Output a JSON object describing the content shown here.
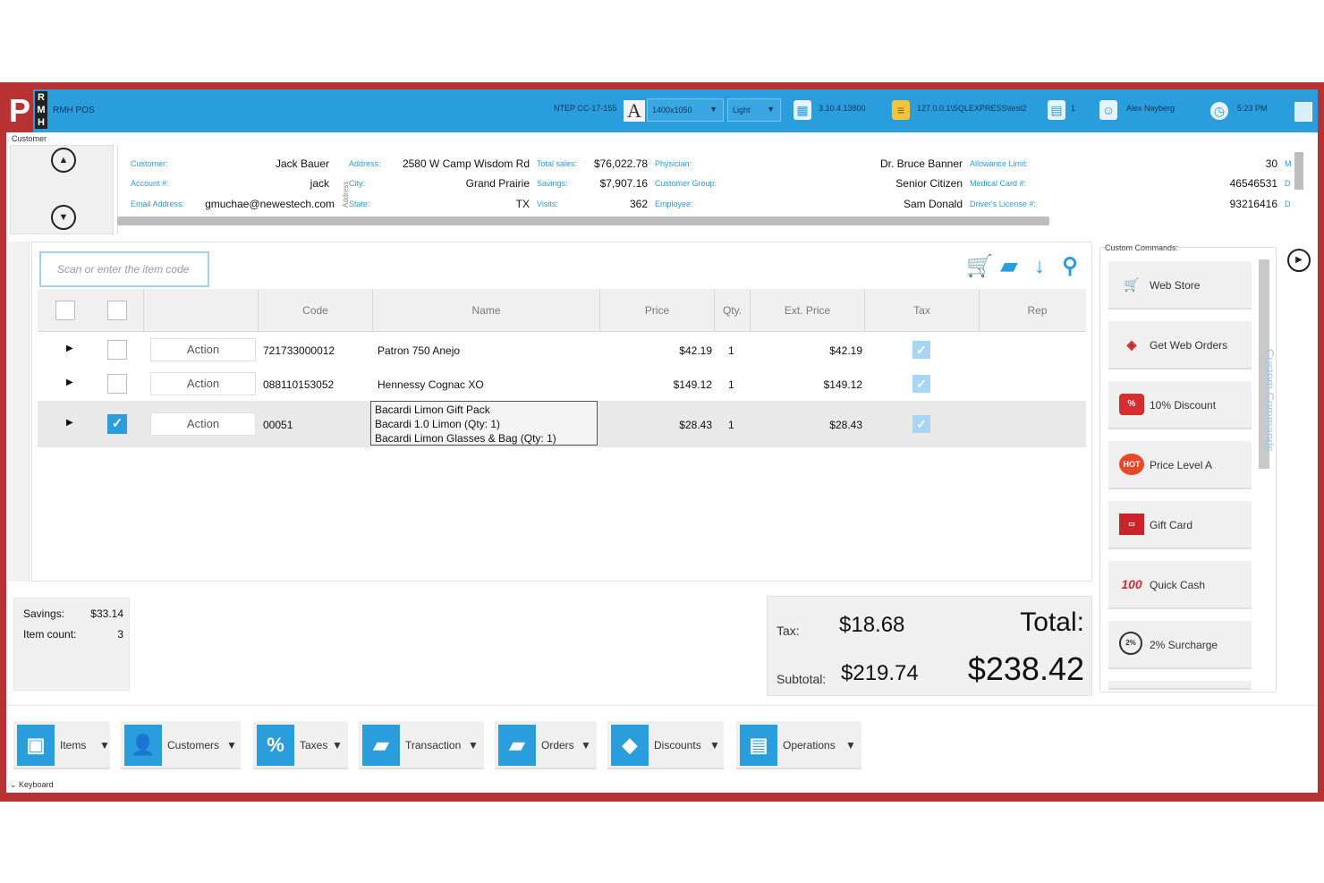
{
  "title_bar": {
    "logo_letter": "P",
    "logo_sub": [
      "R",
      "M",
      "H"
    ],
    "app_title": "RMH POS",
    "terminal": "NTEP CC-17-155",
    "resolution": "1400x1050",
    "theme": "Light",
    "version": "3.10.4.13800",
    "database": "127.0.0.1\\SQLEXPRESS\\test2",
    "register_count": "1",
    "user": "Alex Nayberg",
    "time": "5:23 PM"
  },
  "customer": {
    "section_label": "Customer",
    "vertical_label": "Address",
    "fields": {
      "customer_label": "Customer:",
      "customer": "Jack Bauer",
      "account_label": "Account #:",
      "account": "jack",
      "email_label": "Email Address:",
      "email": "gmuchae@newestech.com",
      "address_label": "Address:",
      "address": "2580 W Camp Wisdom Rd",
      "city_label": "City:",
      "city": "Grand Prairie",
      "state_label": "State:",
      "state": "TX",
      "total_sales_label": "Total sales:",
      "total_sales": "$76,022.78",
      "savings_label": "Savings:",
      "savings": "$7,907.16",
      "visits_label": "Visits:",
      "visits": "362",
      "physician_label": "Physician:",
      "physician": "Dr. Bruce Banner",
      "group_label": "Customer Group:",
      "group": "Senior Citizen",
      "employee_label": "Employee:",
      "employee": "Sam Donald",
      "allowance_label": "Allowance Limit:",
      "allowance": "30",
      "medical_label": "Medical Card #:",
      "medical": "46546531",
      "license_label": "Driver's License #:",
      "license": "93216416",
      "col6_partial": [
        "M",
        "D",
        "D"
      ]
    }
  },
  "scan": {
    "placeholder": "Scan or enter the item code"
  },
  "grid": {
    "headers": [
      "Code",
      "Name",
      "Price",
      "Qty.",
      "Ext. Price",
      "Tax",
      "Rep"
    ],
    "action_label": "Action",
    "rows": [
      {
        "code": "721733000012",
        "name": "Patron 750 Anejo",
        "price": "$42.19",
        "qty": "1",
        "ext": "$42.19",
        "checked": false,
        "tax": true
      },
      {
        "code": "088110153052",
        "name": "Hennessy Cognac XO",
        "price": "$149.12",
        "qty": "1",
        "ext": "$149.12",
        "checked": false,
        "tax": true
      },
      {
        "code": "00051",
        "name_lines": [
          "Bacardi Limon Gift Pack",
          "Bacardi 1.0 Limon (Qty: 1)",
          "Bacardi Limon Glasses & Bag (Qty: 1)"
        ],
        "price": "$28.43",
        "qty": "1",
        "ext": "$28.43",
        "checked": true,
        "tax": true
      }
    ]
  },
  "stats": {
    "savings_label": "Savings:",
    "savings": "$33.14",
    "count_label": "Item count:",
    "count": "3"
  },
  "totals": {
    "tax_label": "Tax:",
    "tax": "$18.68",
    "subtotal_label": "Subtotal:",
    "subtotal": "$219.74",
    "total_label": "Total:",
    "total": "$238.42"
  },
  "custom_commands": {
    "label": "Custom Commands:",
    "vertical_label": "Custom Commands",
    "buttons": [
      "Web Store",
      "Get Web Orders",
      "10% Discount",
      "Price Level A",
      "Gift Card",
      "Quick Cash",
      "2% Surcharge"
    ]
  },
  "bottom_toolbar": {
    "buttons": [
      "Items",
      "Customers",
      "Taxes",
      "Transaction",
      "Orders",
      "Discounts",
      "Operations"
    ]
  },
  "keyboard_label": "Keyboard",
  "colors": {
    "accent": "#2a9ddd",
    "frame": "#b73232"
  }
}
